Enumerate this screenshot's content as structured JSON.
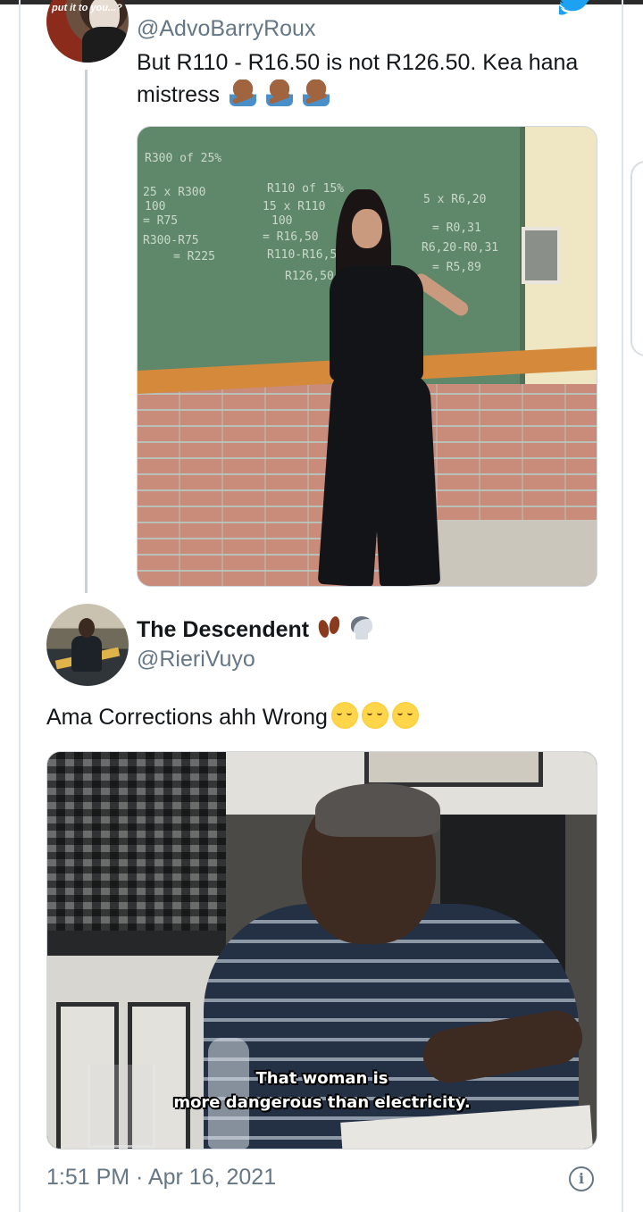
{
  "tweet1": {
    "avatar_text": "put it to you...?",
    "handle": "@AdvoBarryRoux",
    "text": "But R110 - R16.50 is not R126.50. Kea hana mistress",
    "emojis": [
      "person-gesturing-no",
      "person-gesturing-no",
      "person-gesturing-no"
    ],
    "image": {
      "chalk_lines": [
        "R300 of 25%",
        "25 x R300",
        "100",
        "= R75",
        "R300-R75",
        "= R225",
        "R110 of 15%",
        "15 x R110",
        "100",
        "= R16,50",
        "R110-R16,50",
        "R126,50",
        "5 x R6,20",
        "= R0,31",
        "R6,20-R0,31",
        "= R5,89"
      ]
    }
  },
  "tweet2": {
    "display_name": "The Descendent",
    "name_emojis": [
      "footprints",
      "skull"
    ],
    "handle": "@RieriVuyo",
    "text": "Ama Corrections ahh Wrong",
    "text_emojis": [
      "relieved-face",
      "relieved-face",
      "relieved-face"
    ],
    "image": {
      "subtitle_line1": "That woman is",
      "subtitle_line2": "more dangerous than electricity."
    },
    "timestamp": "1:51 PM · Apr 16, 2021",
    "info_icon_glyph": "i"
  },
  "colors": {
    "text": "#14171a",
    "secondary": "#657786",
    "twitter_blue": "#1da1f2",
    "thread_line": "#c7d1d9"
  }
}
